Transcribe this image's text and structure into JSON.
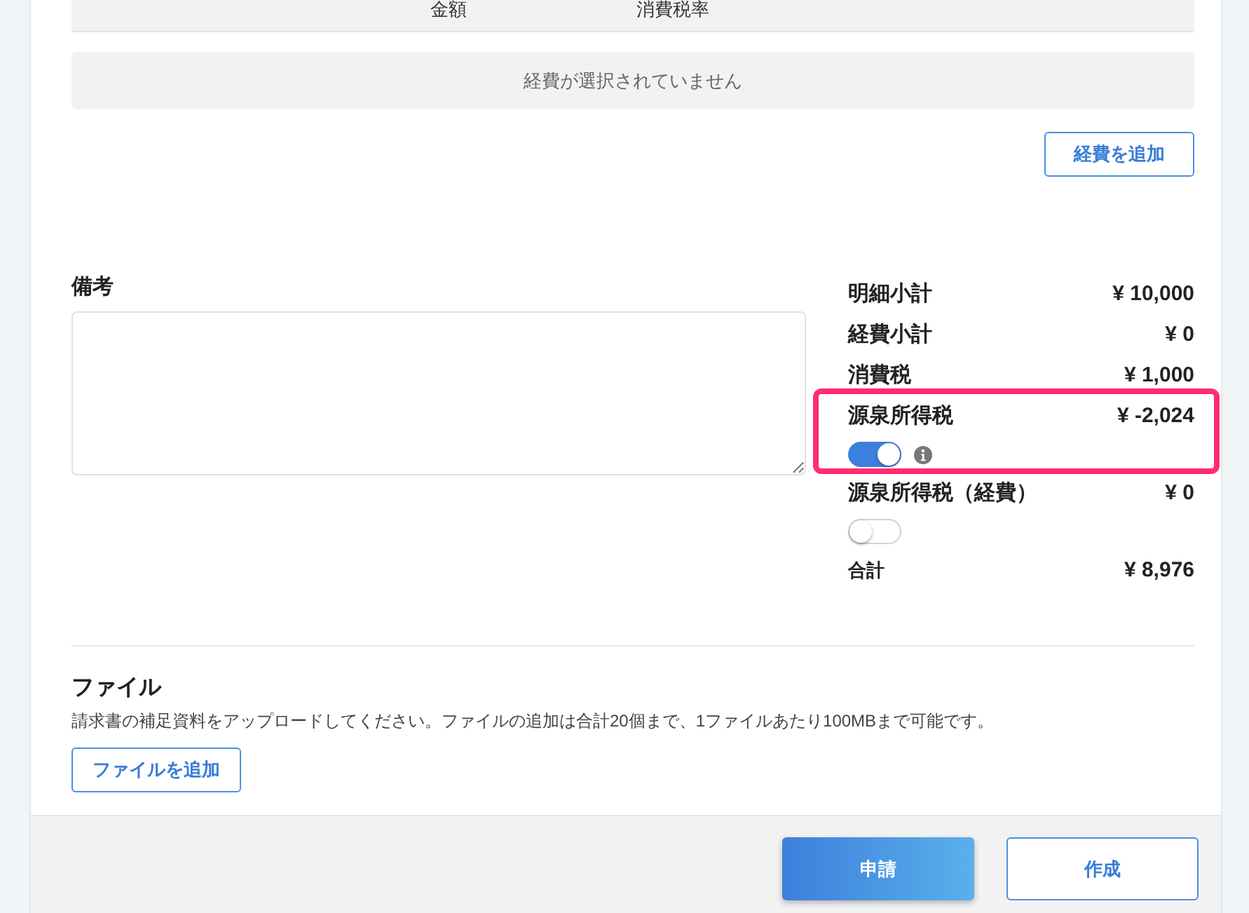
{
  "expense_table": {
    "columns": [
      {
        "label": "金額"
      },
      {
        "label": "消費税率"
      }
    ],
    "empty_message": "経費が選択されていません",
    "add_button": "経費を追加"
  },
  "remarks": {
    "label": "備考"
  },
  "summary": {
    "rows": [
      {
        "kind": "line",
        "label": "明細小計",
        "value": "¥ 10,000"
      },
      {
        "kind": "line",
        "label": "経費小計",
        "value": "¥ 0"
      },
      {
        "kind": "line",
        "label": "消費税",
        "value": "¥ 1,000"
      },
      {
        "kind": "toggle",
        "label": "源泉所得税",
        "value": "¥ -2,024",
        "on": true,
        "info": true,
        "highlighted": true
      },
      {
        "kind": "toggle",
        "label": "源泉所得税（経費）",
        "value": "¥ 0",
        "on": false,
        "info": false,
        "highlighted": false
      },
      {
        "kind": "total",
        "label": "合計",
        "value": "¥ 8,976"
      }
    ]
  },
  "files": {
    "title": "ファイル",
    "description": "請求書の補足資料をアップロードしてください。ファイルの追加は合計20個まで、1ファイルあたり100MBまで可能です。",
    "add_button": "ファイルを追加"
  },
  "footer": {
    "buttons": [
      {
        "kind": "primary",
        "label": "申請"
      },
      {
        "kind": "secondary",
        "label": "作成"
      }
    ]
  }
}
